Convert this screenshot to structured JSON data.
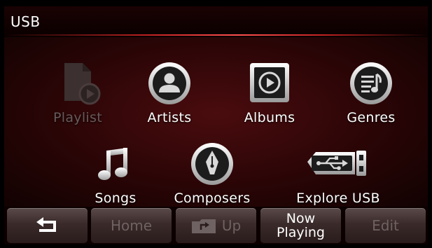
{
  "header": {
    "title": "USB"
  },
  "grid": {
    "row1": [
      {
        "label": "Playlist",
        "icon": "playlist-icon",
        "enabled": false
      },
      {
        "label": "Artists",
        "icon": "artist-icon",
        "enabled": true
      },
      {
        "label": "Albums",
        "icon": "album-icon",
        "enabled": true
      },
      {
        "label": "Genres",
        "icon": "genre-icon",
        "enabled": true
      }
    ],
    "row2": [
      {
        "label": "Songs",
        "icon": "music-note-icon",
        "enabled": true
      },
      {
        "label": "Composers",
        "icon": "pen-nib-icon",
        "enabled": true
      },
      {
        "label": "Explore USB",
        "icon": "usb-icon",
        "enabled": true
      }
    ]
  },
  "softkeys": {
    "back": {
      "icon": "back-arrow-icon"
    },
    "home": {
      "label": "Home",
      "enabled": false
    },
    "up": {
      "label": "Up",
      "icon": "folder-up-icon",
      "enabled": false
    },
    "now_playing": {
      "line1": "Now",
      "line2": "Playing"
    },
    "edit": {
      "label": "Edit",
      "enabled": false
    }
  },
  "colors": {
    "accent_line": "#c42222",
    "background": "#2a0506",
    "disabled_text": "#6f6262"
  }
}
